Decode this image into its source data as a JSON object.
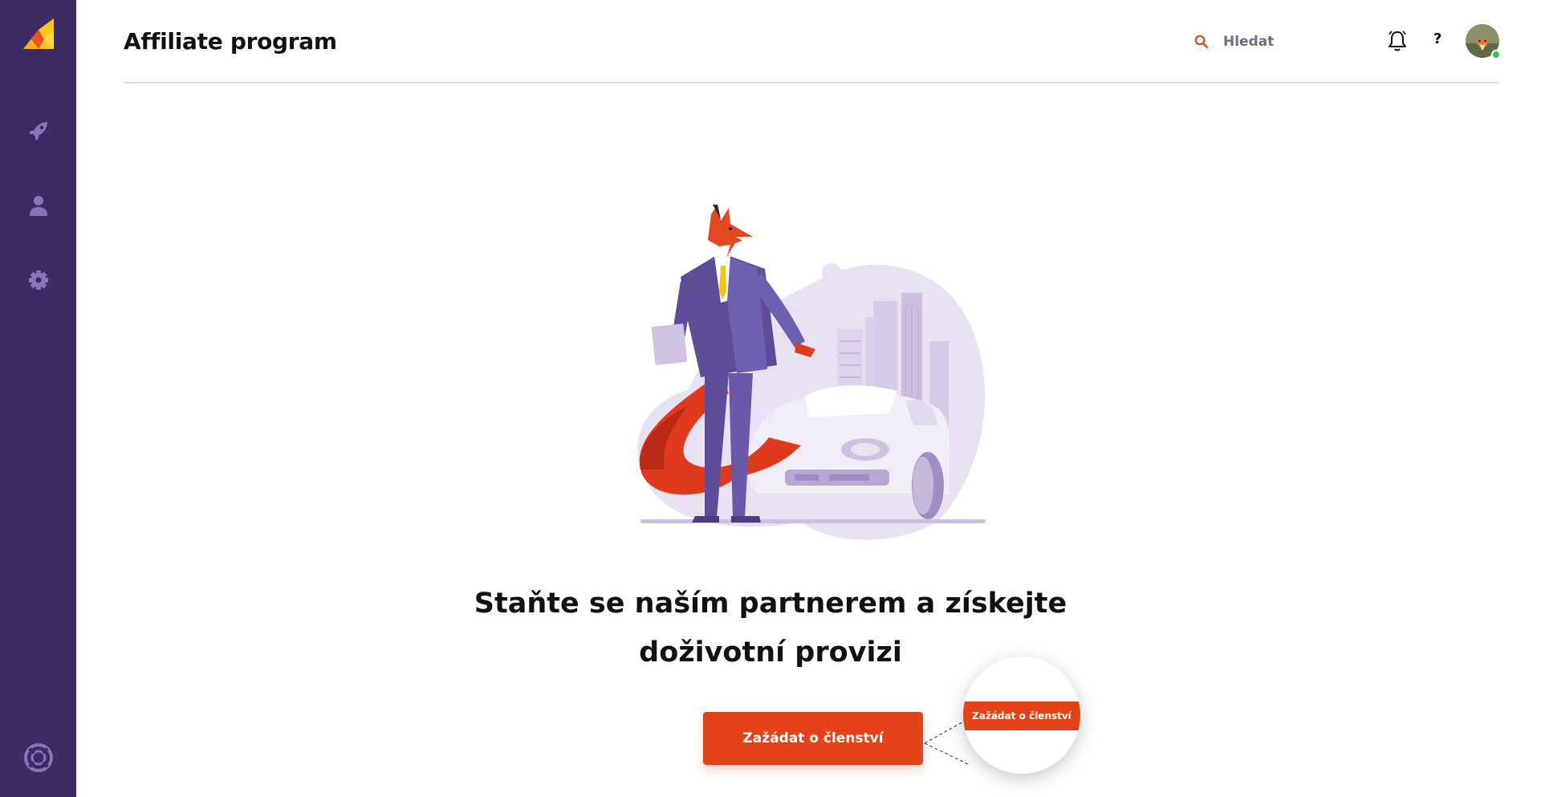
{
  "app": {
    "logo_icon": "brand-logo-icon"
  },
  "sidebar": {
    "items": [
      {
        "icon": "rocket-icon"
      },
      {
        "icon": "user-icon"
      },
      {
        "icon": "gear-icon"
      }
    ],
    "bottom_icon": "lifebuoy-icon"
  },
  "header": {
    "title": "Affiliate program",
    "search": {
      "placeholder": "Hledat",
      "icon": "search-icon"
    },
    "bell_icon": "bell-icon",
    "help_label": "?",
    "avatar_status": "online"
  },
  "main": {
    "illustration_icon": "fox-businessman-with-car-illustration",
    "headline_line1": "Staňte se naším partnerem a získejte",
    "headline_line2": "doživotní provizi",
    "cta_label": "Zažádat o členství",
    "zoom_label": "Zažádat o členství"
  },
  "colors": {
    "sidebar": "#3f2b63",
    "accent": "#e4431a",
    "sidebar_icon": "#8b74b8",
    "online": "#33c24b"
  }
}
